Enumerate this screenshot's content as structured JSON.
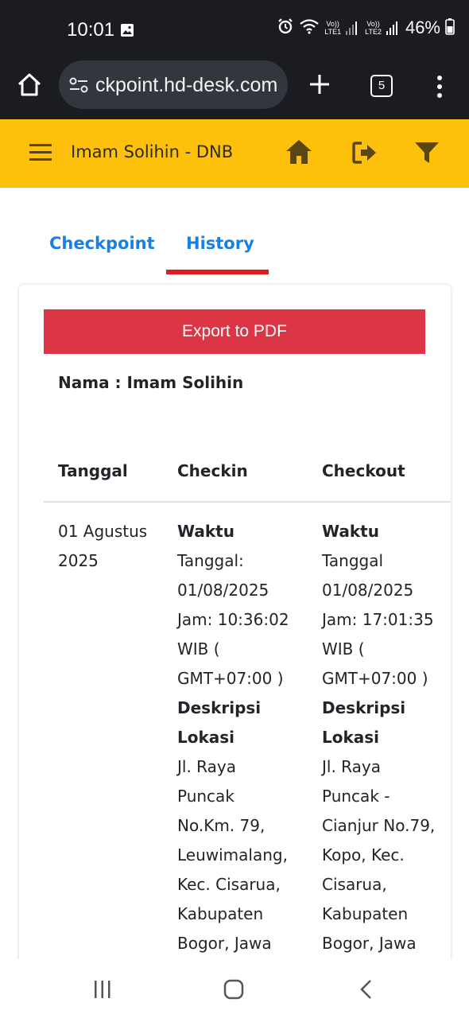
{
  "status_bar": {
    "time": "10:01",
    "sim1_label": "Vo))",
    "sim1_sub": "LTE1",
    "sim2_label": "Vo))",
    "sim2_sub": "LTE2",
    "battery": "46%",
    "icons": [
      "image-icon",
      "alarm-icon",
      "wifi-icon",
      "signal-icon",
      "battery-icon"
    ]
  },
  "browser": {
    "url": "ckpoint.hd-desk.com",
    "tab_count": "5",
    "icons": [
      "home-icon",
      "site-settings-icon",
      "new-tab-icon",
      "more-icon"
    ]
  },
  "app_header": {
    "title": "Imam Solihin - DNB",
    "accent_color": "#fdc10c",
    "icons": [
      "menu-icon",
      "home-icon",
      "logout-icon",
      "filter-icon"
    ]
  },
  "tabs": [
    {
      "label": "Checkpoint",
      "active": false
    },
    {
      "label": "History",
      "active": true
    }
  ],
  "card": {
    "export_label": "Export to PDF",
    "export_color": "#dc3545",
    "nama_label": "Nama : Imam Solihin",
    "columns": [
      "Tanggal",
      "Checkin",
      "Checkout"
    ],
    "row": {
      "tanggal": [
        "01 Agustus",
        "2025"
      ],
      "checkin": {
        "waktu_label": "Waktu",
        "waktu_lines": [
          "Tanggal:",
          "01/08/2025",
          "Jam: 10:36:02",
          "WIB (",
          "GMT+07:00 )"
        ],
        "desc_label_1": "Deskripsi",
        "desc_label_2": "Lokasi",
        "desc_lines": [
          "Jl. Raya",
          "Puncak",
          "No.Km. 79,",
          "Leuwimalang,",
          "Kec. Cisarua,",
          "Kabupaten",
          "Bogor, Jawa"
        ]
      },
      "checkout": {
        "waktu_label": "Waktu",
        "waktu_lines": [
          "Tanggal",
          "01/08/2025",
          "Jam: 17:01:35",
          "WIB (",
          "GMT+07:00 )"
        ],
        "desc_label_1": "Deskripsi",
        "desc_label_2": "Lokasi",
        "desc_lines": [
          "Jl. Raya",
          "Puncak -",
          "Cianjur No.79,",
          "Kopo, Kec.",
          "Cisarua,",
          "Kabupaten",
          "Bogor, Jawa"
        ]
      }
    }
  },
  "nav": {
    "icons": [
      "recent-apps-icon",
      "home-button-icon",
      "back-icon"
    ]
  }
}
